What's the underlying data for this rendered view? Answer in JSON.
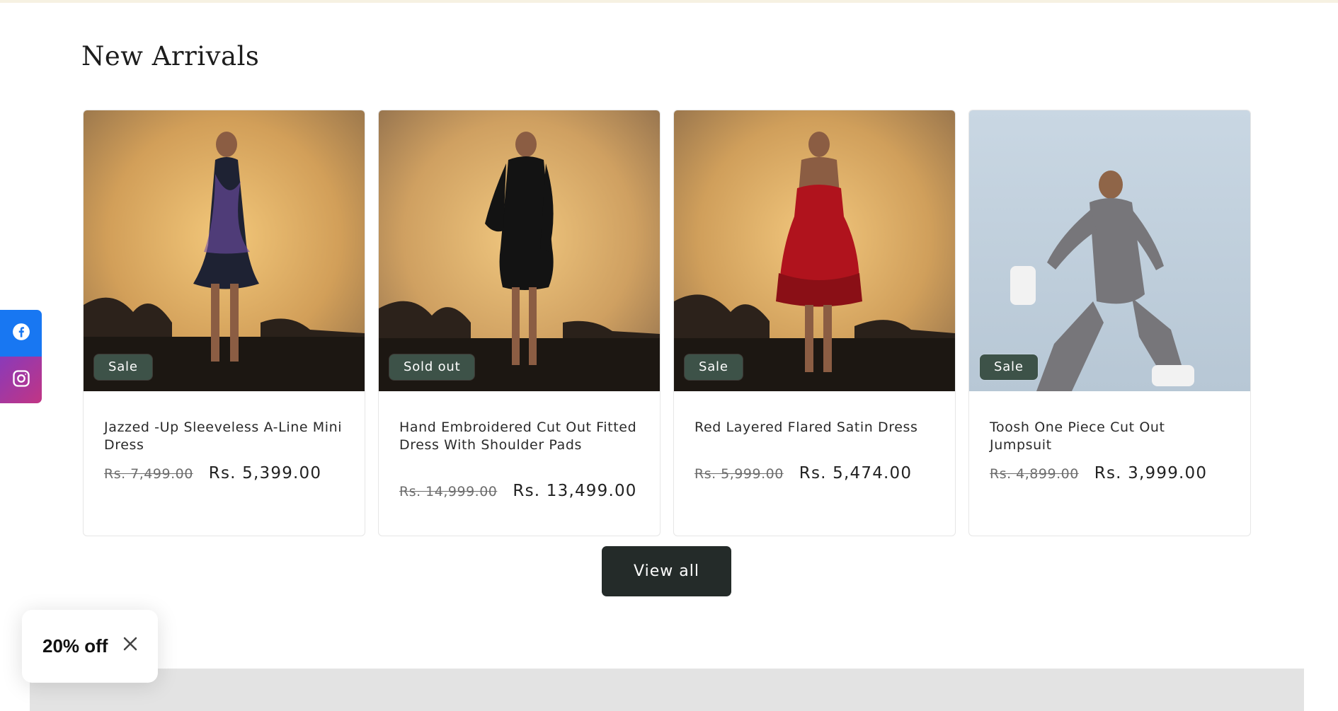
{
  "section": {
    "title": "New Arrivals"
  },
  "products": [
    {
      "name": "Jazzed -Up Sleeveless A-Line Mini Dress",
      "badge": "Sale",
      "price_original": "Rs. 7,499.00",
      "price_sale": "Rs. 5,399.00"
    },
    {
      "name": "Hand Embroidered Cut Out Fitted Dress With Shoulder Pads",
      "badge": "Sold out",
      "price_original": "Rs. 14,999.00",
      "price_sale": "Rs. 13,499.00"
    },
    {
      "name": "Red Layered Flared Satin Dress",
      "badge": "Sale",
      "price_original": "Rs. 5,999.00",
      "price_sale": "Rs. 5,474.00"
    },
    {
      "name": "Toosh One Piece Cut Out Jumpsuit",
      "badge": "Sale",
      "price_original": "Rs. 4,899.00",
      "price_sale": "Rs. 3,999.00"
    }
  ],
  "view_all": {
    "label": "View all"
  },
  "social": {
    "facebook_icon": "facebook-icon",
    "instagram_icon": "instagram-icon"
  },
  "promo": {
    "text": "20% off",
    "close_icon": "close-icon"
  },
  "colors": {
    "badge": "#3d5248",
    "button": "#242b29",
    "facebook": "#1877f2",
    "instagram": "#a83ba0"
  }
}
